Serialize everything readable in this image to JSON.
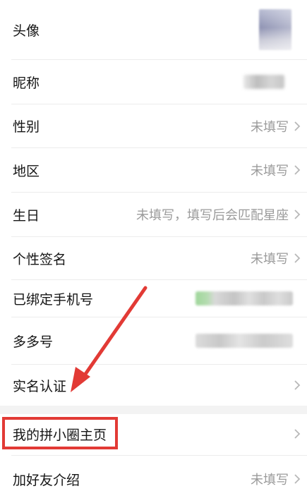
{
  "rows": [
    {
      "label": "头像",
      "value": ""
    },
    {
      "label": "昵称",
      "value": ""
    },
    {
      "label": "性别",
      "value": "未填写"
    },
    {
      "label": "地区",
      "value": "未填写"
    },
    {
      "label": "生日",
      "value": "未填写，填写后会匹配星座"
    },
    {
      "label": "个性签名",
      "value": "未填写"
    },
    {
      "label": "已绑定手机号",
      "value": ""
    },
    {
      "label": "多多号",
      "value": ""
    },
    {
      "label": "实名认证",
      "value": ""
    },
    {
      "label": "我的拼小圈主页",
      "value": ""
    },
    {
      "label": "加好友介绍",
      "value": "未填写"
    }
  ],
  "icons": {
    "chevron": "chevron-right-icon"
  },
  "colors": {
    "highlight": "#e23a35",
    "arrow": "#e23a35",
    "value_text": "#9b9b9b",
    "phone_blur_green": "#9fd69a"
  }
}
